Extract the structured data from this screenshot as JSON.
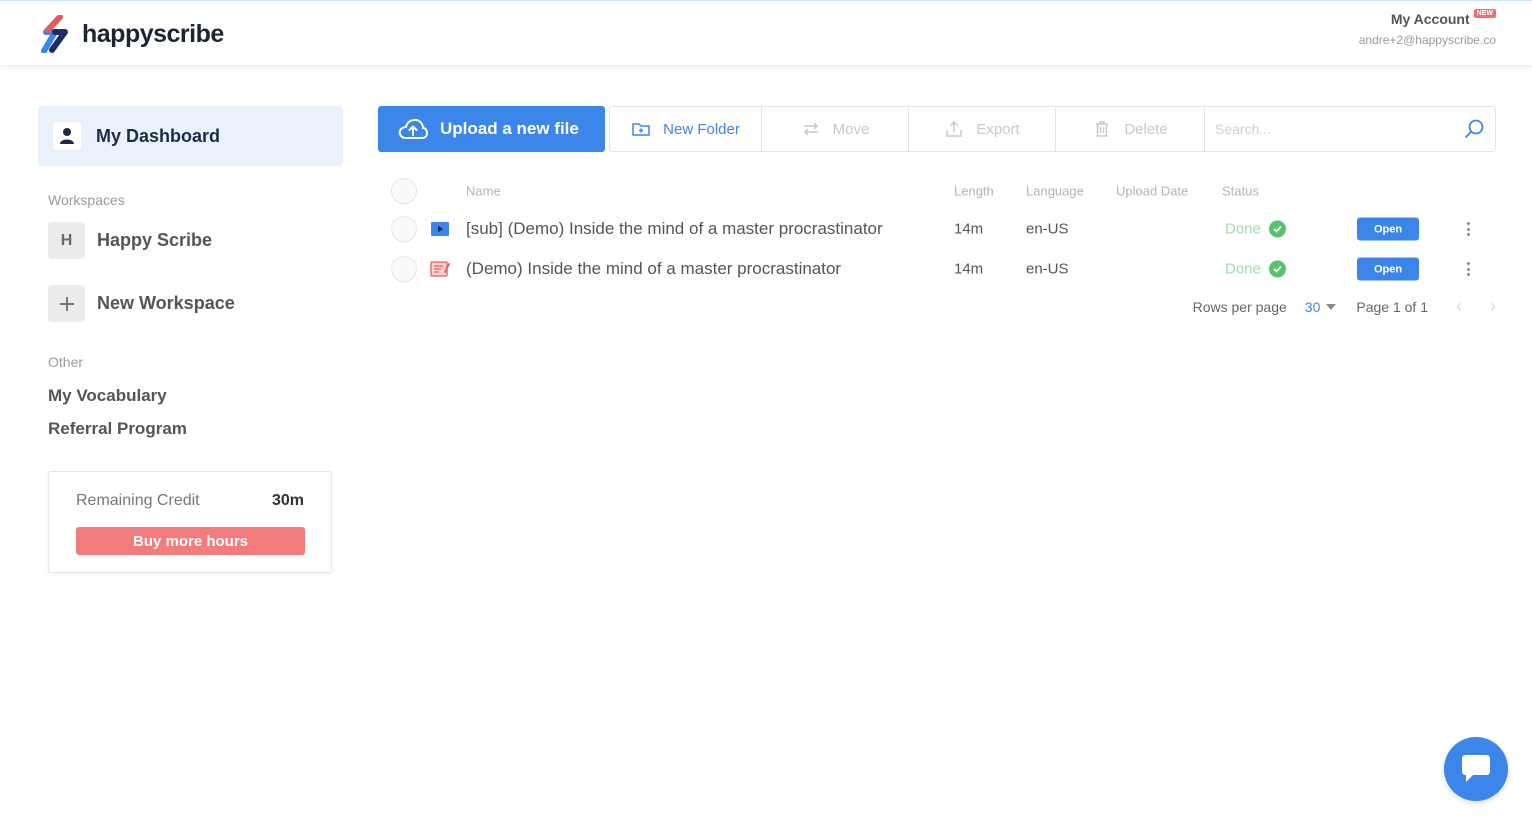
{
  "header": {
    "brand": "happyscribe",
    "account_title": "My Account",
    "account_badge": "NEW",
    "account_email": "andre+2@happyscribe.co"
  },
  "sidebar": {
    "dashboard_label": "My Dashboard",
    "workspaces_heading": "Workspaces",
    "workspaces": [
      {
        "initial": "H",
        "label": "Happy Scribe"
      }
    ],
    "new_workspace_label": "New Workspace",
    "other_heading": "Other",
    "other_links": [
      "My Vocabulary",
      "Referral Program"
    ],
    "credit": {
      "label": "Remaining Credit",
      "value": "30m",
      "buy_label": "Buy more hours"
    }
  },
  "toolbar": {
    "upload_label": "Upload a new file",
    "new_folder_label": "New Folder",
    "move_label": "Move",
    "export_label": "Export",
    "delete_label": "Delete",
    "search_placeholder": "Search..."
  },
  "table": {
    "columns": {
      "name": "Name",
      "length": "Length",
      "language": "Language",
      "upload_date": "Upload Date",
      "status": "Status"
    },
    "rows": [
      {
        "icon": "video-file-icon",
        "name": "[sub] (Demo) Inside the mind of a master procrastinator",
        "length": "14m",
        "language": "en-US",
        "upload_date": "",
        "status": "Done",
        "action": "Open"
      },
      {
        "icon": "transcript-file-icon",
        "name": "(Demo) Inside the mind of a master procrastinator",
        "length": "14m",
        "language": "en-US",
        "upload_date": "",
        "status": "Done",
        "action": "Open"
      }
    ],
    "pager": {
      "rows_per_page_label": "Rows per page",
      "rows_per_page": "30",
      "page_text": "Page 1 of 1"
    }
  },
  "colors": {
    "accent": "#3d86e9",
    "buy": "#f27c7c",
    "done": "#56c46d"
  }
}
